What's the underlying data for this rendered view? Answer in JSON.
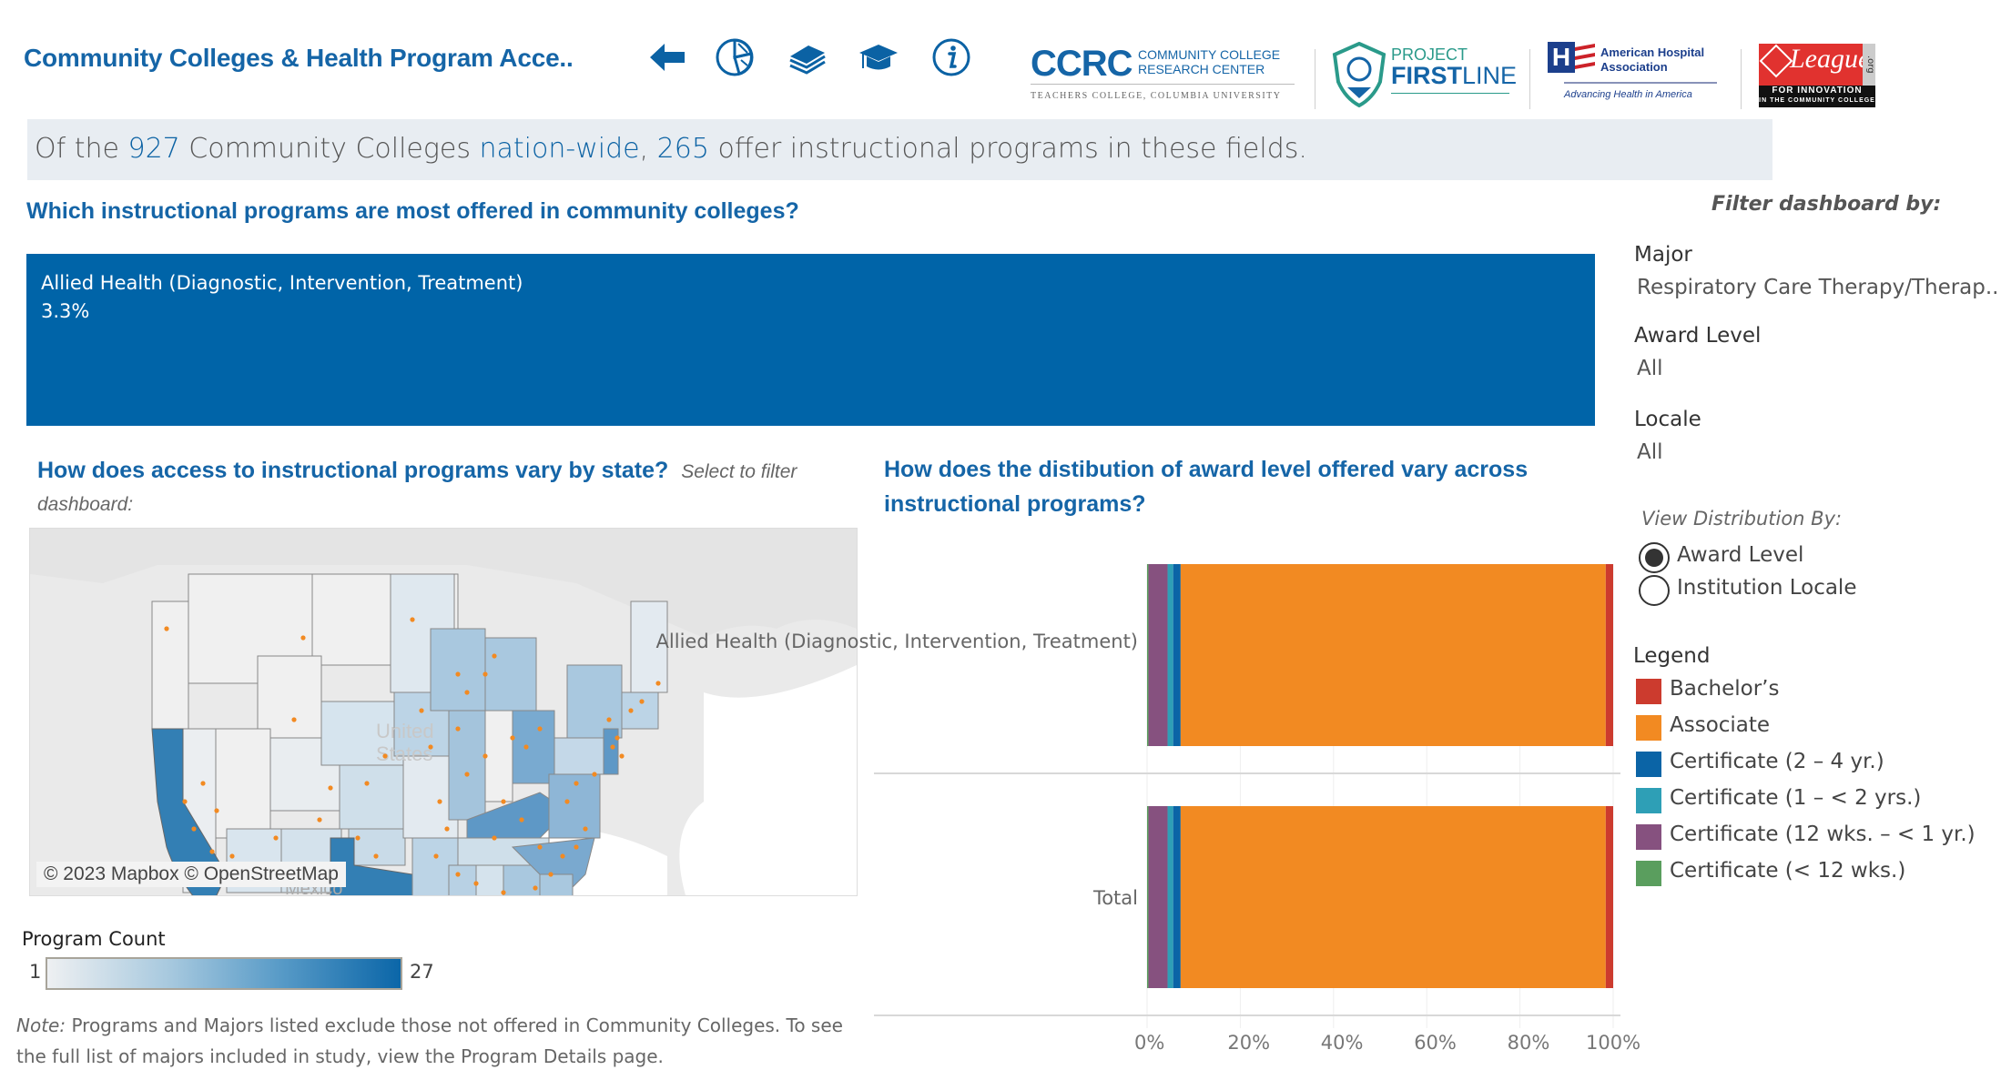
{
  "header": {
    "title": "Community Colleges & Health Program Acce..",
    "nav_icons": [
      "back-arrow-icon",
      "pie-chart-icon",
      "books-icon",
      "graduation-cap-icon",
      "info-icon"
    ],
    "logos": [
      {
        "name": "CCRC",
        "line1": "COMMUNITY COLLEGE",
        "line2": "RESEARCH CENTER",
        "sub": "TEACHERS COLLEGE, COLUMBIA UNIVERSITY"
      },
      {
        "name": "Project Firstline",
        "line1": "PROJECT",
        "line2a": "FIRST",
        "line2b": "LINE"
      },
      {
        "name": "American Hospital Association",
        "line1": "American Hospital",
        "line2": "Association",
        "sub": "Advancing Health in America"
      },
      {
        "name": "League for Innovation",
        "script": "League",
        "org": ".org",
        "line1": "FOR INNOVATION",
        "line2": "IN THE COMMUNITY COLLEGE"
      }
    ]
  },
  "banner": {
    "pre": "Of the ",
    "total": "927",
    "mid1": " Community Colleges ",
    "scope": "nation-wide",
    "mid2": ", ",
    "count": "265",
    "post": " offer instructional programs in these fields."
  },
  "treemap": {
    "heading": "Which instructional programs are most offered in community colleges?",
    "items": [
      {
        "label": "Allied Health (Diagnostic, Intervention, Treatment)",
        "value": "3.3%"
      }
    ]
  },
  "map": {
    "heading": "How does access to instructional programs vary by state?",
    "subheading": "Select to filter dashboard:",
    "attribution": "© 2023 Mapbox © OpenStreetMap",
    "labels": {
      "country": "United States",
      "mexico": "Mexico"
    },
    "legend": {
      "title": "Program Count",
      "min": "1",
      "max": "27"
    }
  },
  "note": {
    "prefix": "Note:",
    "text": " Programs and Majors listed exclude those not offered in Community Colleges.  To see the full list of majors included in study, view the Program Details page."
  },
  "filters": {
    "title": "Filter dashboard by:",
    "items": [
      {
        "label": "Major",
        "value": "Respiratory Care Therapy/Therap.."
      },
      {
        "label": "Award Level",
        "value": "All"
      },
      {
        "label": "Locale",
        "value": "All"
      }
    ]
  },
  "view_distribution": {
    "title": "View Distribution By:",
    "options": [
      {
        "label": "Award Level",
        "selected": true
      },
      {
        "label": "Institution Locale",
        "selected": false
      }
    ]
  },
  "legend": {
    "title": "Legend",
    "items": [
      {
        "label": "Bachelor’s",
        "color": "#cc3b2e"
      },
      {
        "label": "Associate",
        "color": "#f28a22"
      },
      {
        "label": "Certificate (2 – 4 yr.)",
        "color": "#0b64a6"
      },
      {
        "label": "Certificate (1 – < 2 yrs.)",
        "color": "#2e9fb6"
      },
      {
        "label": "Certificate (12 wks. – < 1 yr.)",
        "color": "#86517f"
      },
      {
        "label": "Certificate (< 12 wks.)",
        "color": "#5a9e5e"
      }
    ]
  },
  "chart_data": {
    "type": "bar",
    "orientation": "horizontal-stacked-100",
    "title": "How does the distibution of award level offered vary across instructional programs?",
    "categories": [
      "Allied Health (Diagnostic, Intervention, Treatment)",
      "Total"
    ],
    "series": [
      {
        "name": "Certificate (< 12 wks.)",
        "color": "#5a9e5e",
        "values": [
          0.3,
          0.3
        ]
      },
      {
        "name": "Certificate (12 wks. – < 1 yr.)",
        "color": "#86517f",
        "values": [
          4.1,
          4.1
        ]
      },
      {
        "name": "Certificate (1 – < 2 yrs.)",
        "color": "#2e9fb6",
        "values": [
          1.2,
          1.2
        ]
      },
      {
        "name": "Certificate (2 – 4 yr.)",
        "color": "#0b64a6",
        "values": [
          1.6,
          1.6
        ]
      },
      {
        "name": "Associate",
        "color": "#f28a22",
        "values": [
          91.2,
          91.2
        ]
      },
      {
        "name": "Bachelor’s",
        "color": "#cc3b2e",
        "values": [
          1.6,
          1.6
        ]
      }
    ],
    "xlim": [
      0,
      100
    ],
    "xticks": [
      "0%",
      "20%",
      "40%",
      "60%",
      "80%",
      "100%"
    ],
    "xlabel": "",
    "ylabel": "",
    "grid": true
  }
}
